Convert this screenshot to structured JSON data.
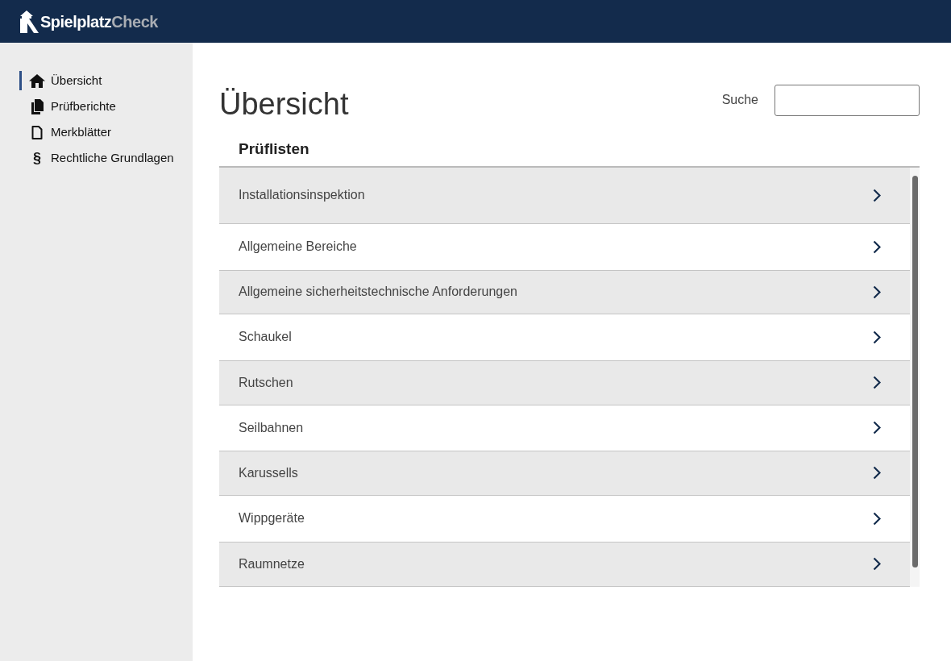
{
  "header": {
    "logo": {
      "primary": "Spielplatz",
      "secondary": "Check"
    }
  },
  "sidebar": {
    "items": [
      {
        "label": "Übersicht",
        "kind": "home",
        "selected": true
      },
      {
        "label": "Prüfberichte",
        "kind": "reports",
        "selected": false
      },
      {
        "label": "Merkblätter",
        "kind": "sheet",
        "selected": false
      },
      {
        "label": "Rechtliche Grundlagen",
        "kind": "glyph",
        "glyph": "§",
        "selected": false
      }
    ]
  },
  "page": {
    "title": "Übersicht",
    "search": {
      "label": "Suche"
    }
  },
  "checklists": {
    "heading": "Prüflisten",
    "items": [
      {
        "label": "Installationsinspektion"
      },
      {
        "label": "Allgemeine Bereiche"
      },
      {
        "label": "Allgemeine sicherheitstechnische Anforderungen"
      },
      {
        "label": "Schaukel"
      },
      {
        "label": "Rutschen"
      },
      {
        "label": "Seilbahnen"
      },
      {
        "label": "Karussells"
      },
      {
        "label": "Wippgeräte"
      },
      {
        "label": "Raumnetze"
      }
    ]
  }
}
